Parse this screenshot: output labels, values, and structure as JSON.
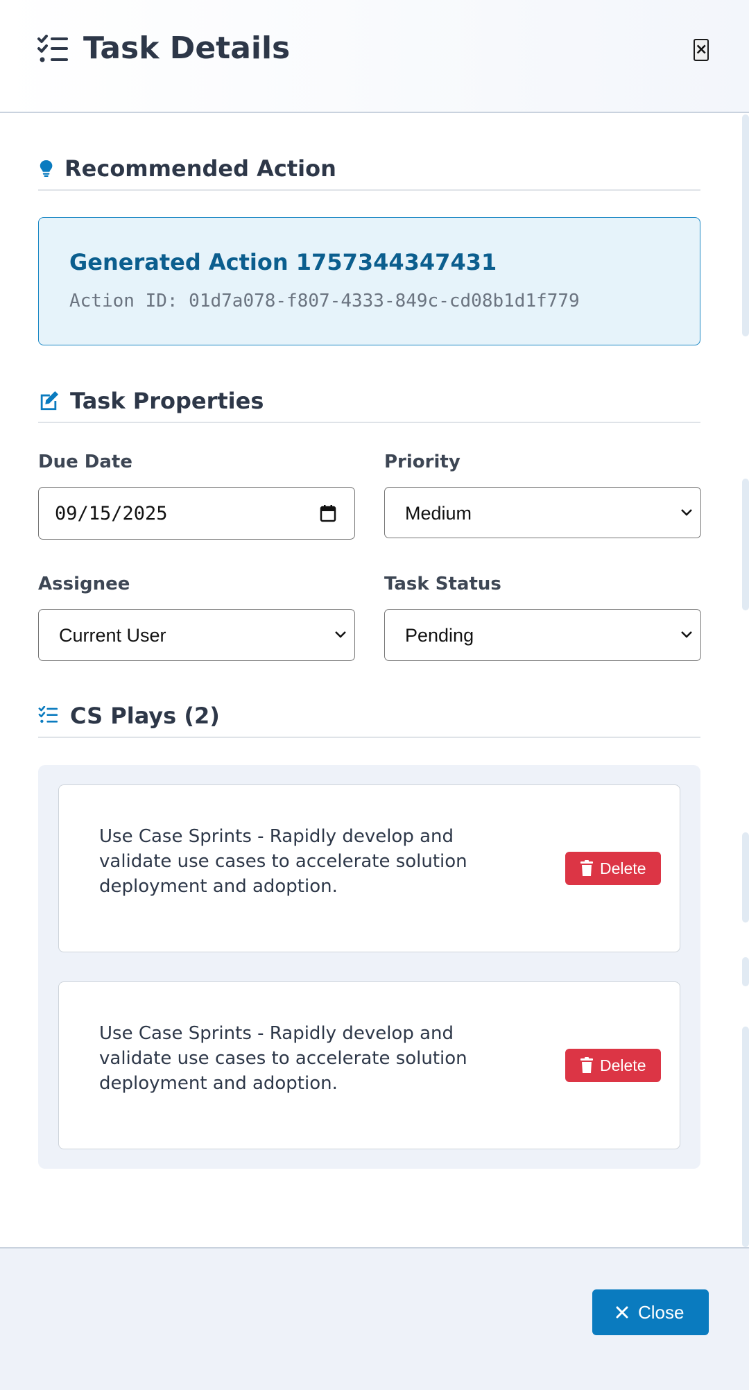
{
  "modal": {
    "title": "Task Details",
    "close_icon_glyph": "×"
  },
  "recommended": {
    "heading": "Recommended Action",
    "action_name": "Generated Action 1757344347431",
    "action_id": "Action ID: 01d7a078-f807-4333-849c-cd08b1d1f779"
  },
  "properties": {
    "heading": "Task Properties",
    "due_date_label": "Due Date",
    "due_date_value": "09/15/2025",
    "priority_label": "Priority",
    "priority_value": "Medium",
    "assignee_label": "Assignee",
    "assignee_value": "Current User",
    "status_label": "Task Status",
    "status_value": "Pending"
  },
  "plays": {
    "heading": "CS Plays (2)",
    "items": [
      {
        "text": "Use Case Sprints - Rapidly develop and validate use cases to accelerate solution deployment and adoption.",
        "delete_label": "Delete"
      },
      {
        "text": "Use Case Sprints - Rapidly develop and validate use cases to accelerate solution deployment and adoption.",
        "delete_label": "Delete"
      }
    ]
  },
  "footer": {
    "close_label": "Close"
  },
  "colors": {
    "accent": "#0a7bbf",
    "danger": "#dc3545",
    "highlight_bg": "#e6f3fa",
    "title_blue": "#0b5e8e"
  },
  "icons": {
    "header": "tasks-list-icon",
    "recommended": "lightbulb-icon",
    "properties": "edit-icon",
    "plays": "tasks-list-icon",
    "delete": "trash-icon",
    "close": "close-icon"
  }
}
